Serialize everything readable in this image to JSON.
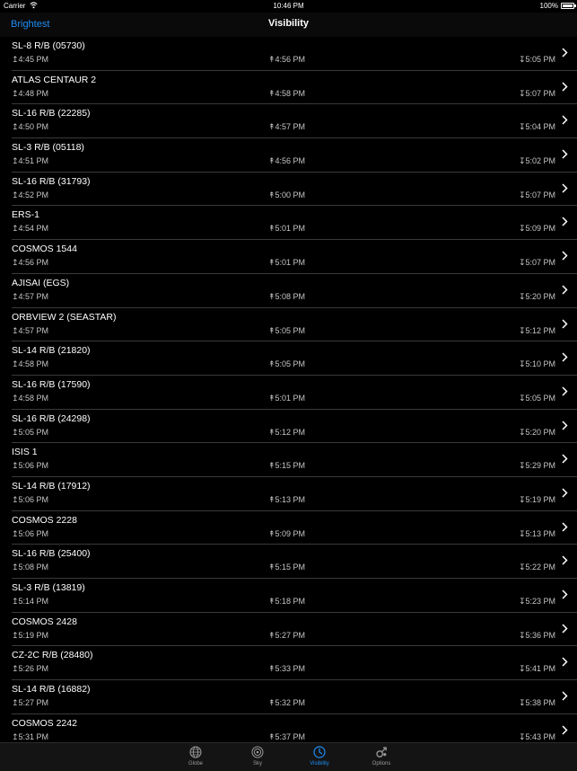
{
  "status": {
    "carrier": "Carrier",
    "time": "10:46 PM",
    "battery": "100%"
  },
  "nav": {
    "back_label": "Brightest",
    "title": "Visibility"
  },
  "passes": [
    {
      "name": "SL-8 R/B (05730)",
      "rise": "↥4:45 PM",
      "max": "↟4:56 PM",
      "set": "↧5:05 PM"
    },
    {
      "name": "ATLAS CENTAUR 2",
      "rise": "↥4:48 PM",
      "max": "↟4:58 PM",
      "set": "↧5:07 PM"
    },
    {
      "name": "SL-16 R/B (22285)",
      "rise": "↥4:50 PM",
      "max": "↟4:57 PM",
      "set": "↧5:04 PM"
    },
    {
      "name": "SL-3 R/B (05118)",
      "rise": "↥4:51 PM",
      "max": "↟4:56 PM",
      "set": "↧5:02 PM"
    },
    {
      "name": "SL-16 R/B (31793)",
      "rise": "↥4:52 PM",
      "max": "↟5:00 PM",
      "set": "↧5:07 PM"
    },
    {
      "name": "ERS-1",
      "rise": "↥4:54 PM",
      "max": "↟5:01 PM",
      "set": "↧5:09 PM"
    },
    {
      "name": "COSMOS 1544",
      "rise": "↥4:56 PM",
      "max": "↟5:01 PM",
      "set": "↧5:07 PM"
    },
    {
      "name": "AJISAI (EGS)",
      "rise": "↥4:57 PM",
      "max": "↟5:08 PM",
      "set": "↧5:20 PM"
    },
    {
      "name": "ORBVIEW 2 (SEASTAR)",
      "rise": "↥4:57 PM",
      "max": "↟5:05 PM",
      "set": "↧5:12 PM"
    },
    {
      "name": "SL-14 R/B (21820)",
      "rise": "↥4:58 PM",
      "max": "↟5:05 PM",
      "set": "↧5:10 PM"
    },
    {
      "name": "SL-16 R/B (17590)",
      "rise": "↥4:58 PM",
      "max": "↟5:01 PM",
      "set": "↧5:05 PM"
    },
    {
      "name": "SL-16 R/B (24298)",
      "rise": "↥5:05 PM",
      "max": "↟5:12 PM",
      "set": "↧5:20 PM"
    },
    {
      "name": "ISIS 1",
      "rise": "↥5:06 PM",
      "max": "↟5:15 PM",
      "set": "↧5:29 PM"
    },
    {
      "name": "SL-14 R/B (17912)",
      "rise": "↥5:06 PM",
      "max": "↟5:13 PM",
      "set": "↧5:19 PM"
    },
    {
      "name": "COSMOS 2228",
      "rise": "↥5:06 PM",
      "max": "↟5:09 PM",
      "set": "↧5:13 PM"
    },
    {
      "name": "SL-16 R/B (25400)",
      "rise": "↥5:08 PM",
      "max": "↟5:15 PM",
      "set": "↧5:22 PM"
    },
    {
      "name": "SL-3 R/B (13819)",
      "rise": "↥5:14 PM",
      "max": "↟5:18 PM",
      "set": "↧5:23 PM"
    },
    {
      "name": "COSMOS 2428",
      "rise": "↥5:19 PM",
      "max": "↟5:27 PM",
      "set": "↧5:36 PM"
    },
    {
      "name": "CZ-2C R/B (28480)",
      "rise": "↥5:26 PM",
      "max": "↟5:33 PM",
      "set": "↧5:41 PM"
    },
    {
      "name": "SL-14 R/B (16882)",
      "rise": "↥5:27 PM",
      "max": "↟5:32 PM",
      "set": "↧5:38 PM"
    },
    {
      "name": "COSMOS 2242",
      "rise": "↥5:31 PM",
      "max": "↟5:37 PM",
      "set": "↧5:43 PM"
    }
  ],
  "tabs": {
    "globe": {
      "label": "Globe",
      "icon": "globe-icon"
    },
    "sky": {
      "label": "Sky",
      "icon": "sky-icon"
    },
    "visibility": {
      "label": "Visibility",
      "icon": "clock-icon",
      "active": true
    },
    "options": {
      "label": "Options",
      "icon": "gender-symbol-icon"
    }
  },
  "colors": {
    "accent": "#1e8ef5",
    "background": "#000000",
    "separator": "#3a3a3c",
    "secondary_text": "#c6c6c6"
  }
}
